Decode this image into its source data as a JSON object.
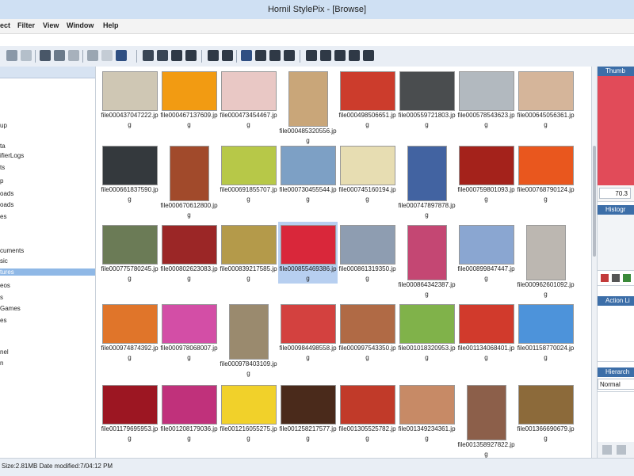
{
  "window": {
    "title": "Hornil StylePix - [Browse]"
  },
  "menu": [
    "ect",
    "Filter",
    "View",
    "Window",
    "Help"
  ],
  "tree": [
    {
      "label": "up"
    },
    {
      "label": "ta"
    },
    {
      "label": "ifierLogs"
    },
    {
      "label": "ts"
    },
    {
      "label": "p"
    },
    {
      "label": "oads"
    },
    {
      "label": "oads"
    },
    {
      "label": "es"
    },
    {
      "label": "cuments"
    },
    {
      "label": "sic"
    },
    {
      "label": "tures"
    },
    {
      "label": "eos"
    },
    {
      "label": "s"
    },
    {
      "label": "Games"
    },
    {
      "label": "es"
    },
    {
      "label": "nel"
    },
    {
      "label": "n"
    }
  ],
  "thumbs": [
    {
      "label": "file000437047222.jpg",
      "color": "#cfc7b4"
    },
    {
      "label": "file000467137609.jpg",
      "color": "#f29b12"
    },
    {
      "label": "file000473454467.jpg",
      "color": "#e9c8c5"
    },
    {
      "label": "file000485320556.jpg",
      "color": "#c9a679"
    },
    {
      "label": "file000498506651.jpg",
      "color": "#cc3c2c"
    },
    {
      "label": "file000559721803.jpg",
      "color": "#4a4d4f"
    },
    {
      "label": "file000578543623.jpg",
      "color": "#b2b9bf"
    },
    {
      "label": "file000645056361.jpg",
      "color": "#d5b59a"
    },
    {
      "label": "file000661837590.jpg",
      "color": "#34393d"
    },
    {
      "label": "file000670612800.jpg",
      "color": "#a14a2b"
    },
    {
      "label": "file000691855707.jpg",
      "color": "#b7c848"
    },
    {
      "label": "file000730455544.jpg",
      "color": "#7da0c5"
    },
    {
      "label": "file000745160194.jpg",
      "color": "#e7ddb2"
    },
    {
      "label": "file000747897878.jpg",
      "color": "#4263a1"
    },
    {
      "label": "file000759801093.jpg",
      "color": "#a4221b"
    },
    {
      "label": "file000768790124.jpg",
      "color": "#e9571e"
    },
    {
      "label": "file000775780245.jpg",
      "color": "#6b7b56"
    },
    {
      "label": "file000802623083.jpg",
      "color": "#9b2626"
    },
    {
      "label": "file000839217585.jpg",
      "color": "#b49a4a"
    },
    {
      "label": "file000855469386.jpg",
      "color": "#d9273a",
      "selected": true
    },
    {
      "label": "file000861319350.jpg",
      "color": "#8e9db1"
    },
    {
      "label": "file000864342387.jpg",
      "color": "#c44773"
    },
    {
      "label": "file000899847447.jpg",
      "color": "#8aa6d1"
    },
    {
      "label": "file000962601092.jpg",
      "color": "#bcb7b1"
    },
    {
      "label": "file000974874392.jpg",
      "color": "#e0752a"
    },
    {
      "label": "file000978068007.jpg",
      "color": "#d34ea6"
    },
    {
      "label": "file000978403109.jpg",
      "color": "#9a8a6e"
    },
    {
      "label": "file000984498558.jpg",
      "color": "#d3413f"
    },
    {
      "label": "file000997543350.jpg",
      "color": "#b06a45"
    },
    {
      "label": "file001018320953.jpg",
      "color": "#80b24a"
    },
    {
      "label": "file001134068401.jpg",
      "color": "#d13a2c"
    },
    {
      "label": "file001158770024.jpg",
      "color": "#4d93da"
    },
    {
      "label": "file001179695953.jpg",
      "color": "#9c1622"
    },
    {
      "label": "file001208179036.jpg",
      "color": "#c0317b"
    },
    {
      "label": "file001216055275.jpg",
      "color": "#f1d12a"
    },
    {
      "label": "file001258217577.jpg",
      "color": "#4a2a1b"
    },
    {
      "label": "file001305525782.jpg",
      "color": "#c13a29"
    },
    {
      "label": "file001349234361.jpg",
      "color": "#c78a66"
    },
    {
      "label": "file001358927822.jpg",
      "color": "#8c5f4a"
    },
    {
      "label": "file001366690679.jpg",
      "color": "#8c6a3a"
    }
  ],
  "right_panel": {
    "thumb_header": "Thumb",
    "zoom_value": "70.3",
    "histogram_header": "Histogr",
    "action_header": "Action Li",
    "hierarchy_header": "Hierarch",
    "blend_mode": "Normal"
  },
  "status": "Size:2.81MB Date modified:7/04:12 PM",
  "colors": {
    "accent": "#3c6ea8",
    "selected": "#b7cff0",
    "toolbar": "#e9eef5"
  }
}
